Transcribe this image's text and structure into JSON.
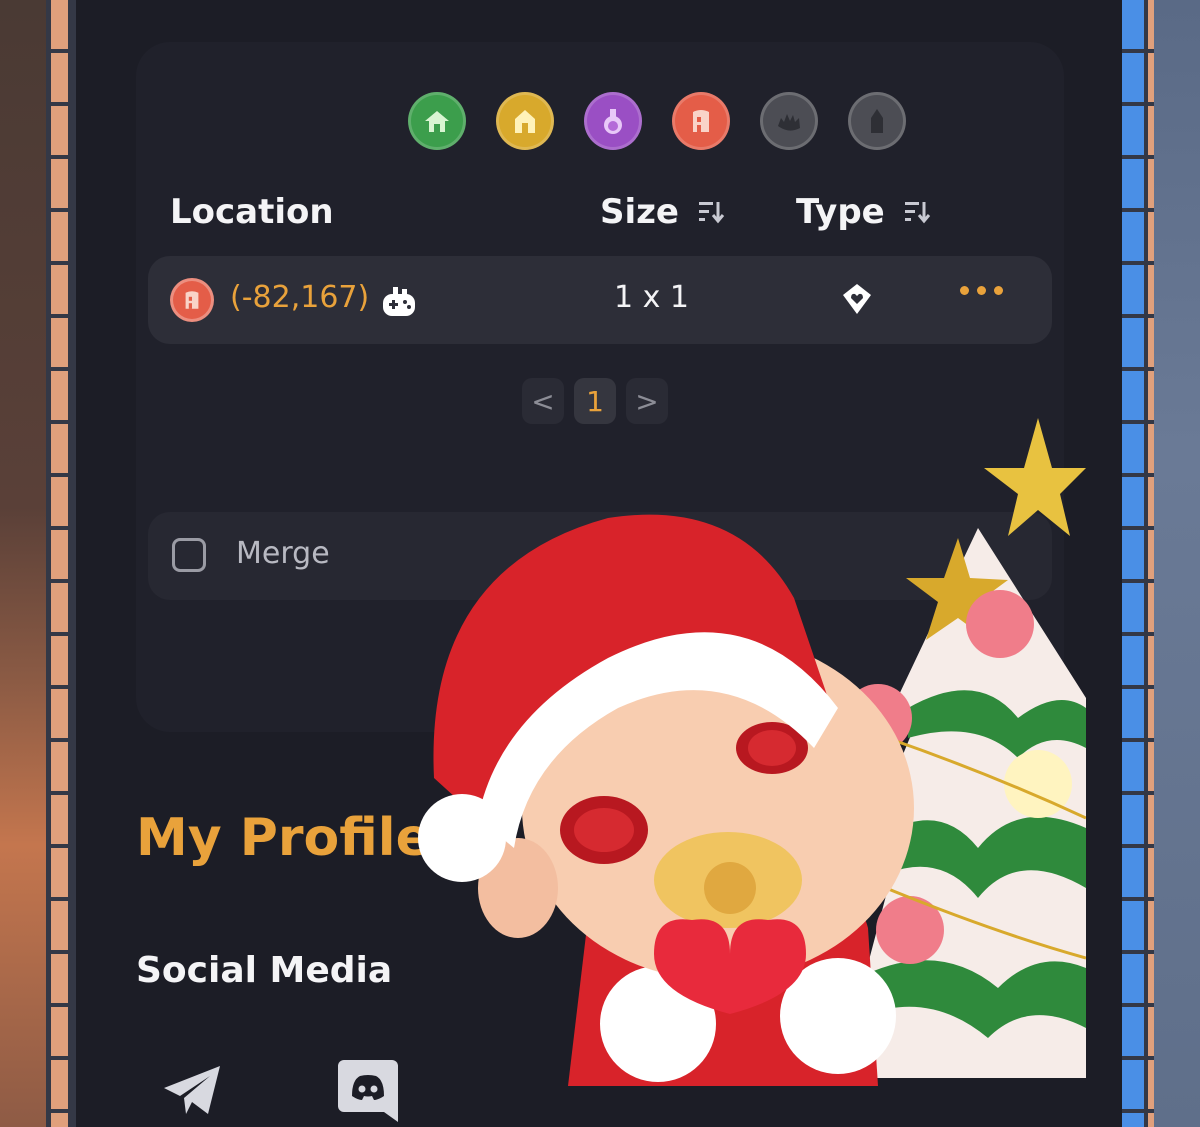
{
  "land_filters": [
    {
      "name": "green-house",
      "color": "#3c9e4c"
    },
    {
      "name": "gold-house",
      "color": "#d8a92c"
    },
    {
      "name": "purple-flask",
      "color": "#9a4fc4"
    },
    {
      "name": "red-building",
      "color": "#e45d48"
    },
    {
      "name": "gray-hedgehog",
      "color": "#4c4d54"
    },
    {
      "name": "gray-tower",
      "color": "#4c4d54"
    }
  ],
  "table": {
    "headers": {
      "location": "Location",
      "size": "Size",
      "type": "Type"
    },
    "rows": [
      {
        "location": "(-82,167)",
        "size": "1 x 1",
        "land_icon": "red-building",
        "type_icon": "heart-diamond"
      }
    ]
  },
  "pagination": {
    "prev": "<",
    "current": "1",
    "next": ">"
  },
  "merge": {
    "merge_label": "Merge",
    "unmerge_label": "merge"
  },
  "profile": {
    "title": "My Profile",
    "social_title": "Social Media"
  },
  "social": [
    "telegram-icon",
    "discord-icon"
  ],
  "colors": {
    "accent": "#e9a23b",
    "panel": "#1c1d26",
    "card": "#20212b",
    "row": "#2d2e38"
  }
}
